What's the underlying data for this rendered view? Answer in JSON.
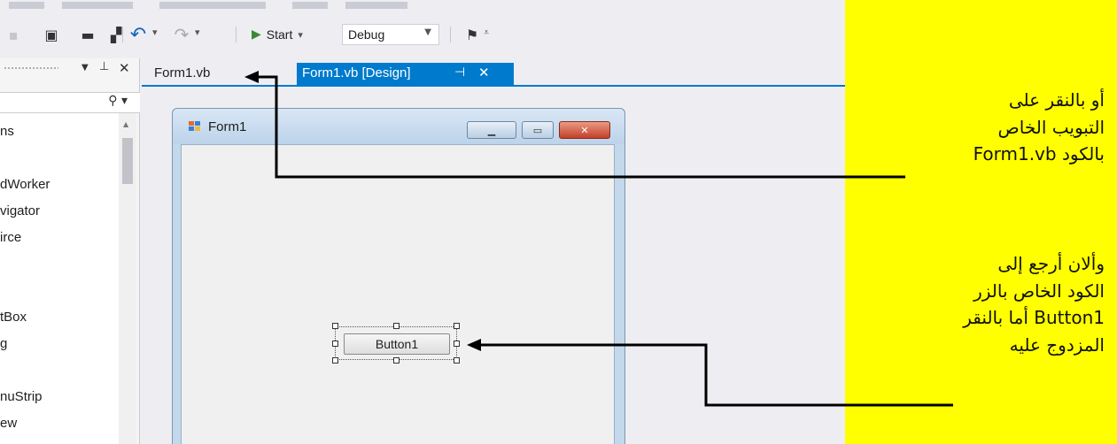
{
  "toolbar": {
    "start_label": "Start",
    "config_value": "Debug"
  },
  "toolbox": {
    "items": [
      "ns",
      "dWorker",
      "vigator",
      "irce",
      "tBox",
      "g",
      "nuStrip",
      "ew"
    ]
  },
  "tabs": {
    "code_tab": "Form1.vb",
    "design_tab": "Form1.vb [Design]"
  },
  "form": {
    "title": "Form1",
    "button_label": "Button1"
  },
  "annotations": {
    "top": [
      "أو بالنقر على",
      "التبويب الخاص",
      "بالكود Form1.vb"
    ],
    "bottom": [
      "وألان أرجع إلى",
      "الكود الخاص بالزر",
      "Button1 أما بالنقر",
      "المزدوج عليه"
    ]
  },
  "colors": {
    "highlight": "#ffff00",
    "accent": "#007acc",
    "run_green": "#388a34"
  }
}
